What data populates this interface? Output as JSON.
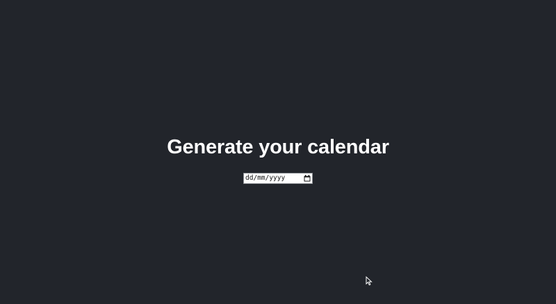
{
  "page": {
    "title": "Generate your calendar"
  },
  "date_input": {
    "placeholder": "dd/mm/yyyy",
    "value": ""
  },
  "icons": {
    "calendar": "calendar-icon",
    "cursor": "mouse-pointer-icon"
  },
  "colors": {
    "background": "#22252b",
    "title": "#ffffff"
  }
}
